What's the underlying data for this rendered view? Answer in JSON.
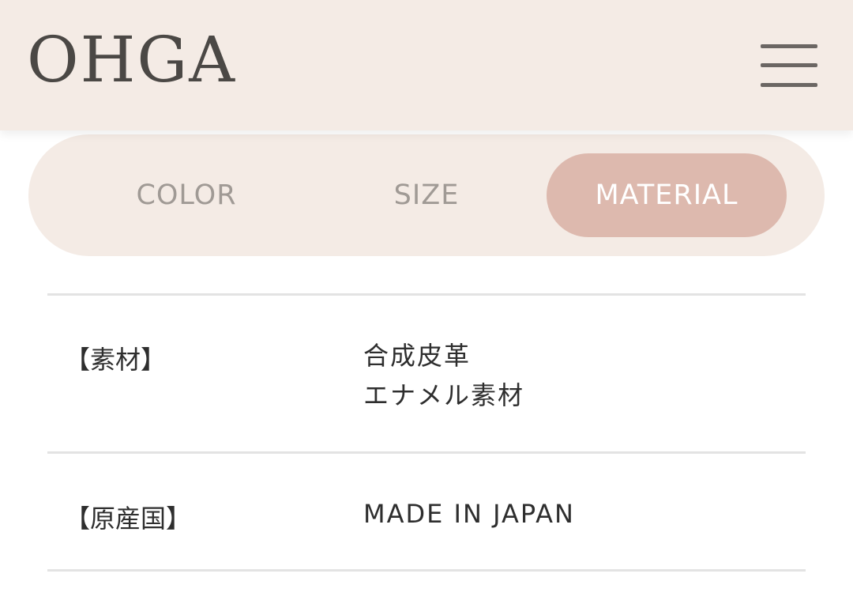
{
  "header": {
    "logo": "OHGA",
    "menu_icon": "hamburger-menu-icon"
  },
  "tabs": [
    {
      "label": "COLOR",
      "active": false
    },
    {
      "label": "SIZE",
      "active": false
    },
    {
      "label": "MATERIAL",
      "active": true
    }
  ],
  "colors": {
    "header_bg": "#f4ebe5",
    "active_tab_bg": "#ddb9ae",
    "inactive_tab_text": "#a09a95"
  },
  "material_table": {
    "rows": [
      {
        "label": "【素材】",
        "values": [
          "合成皮革",
          "エナメル素材"
        ]
      },
      {
        "label": "【原産国】",
        "values": [
          "MADE IN JAPAN"
        ]
      }
    ]
  }
}
